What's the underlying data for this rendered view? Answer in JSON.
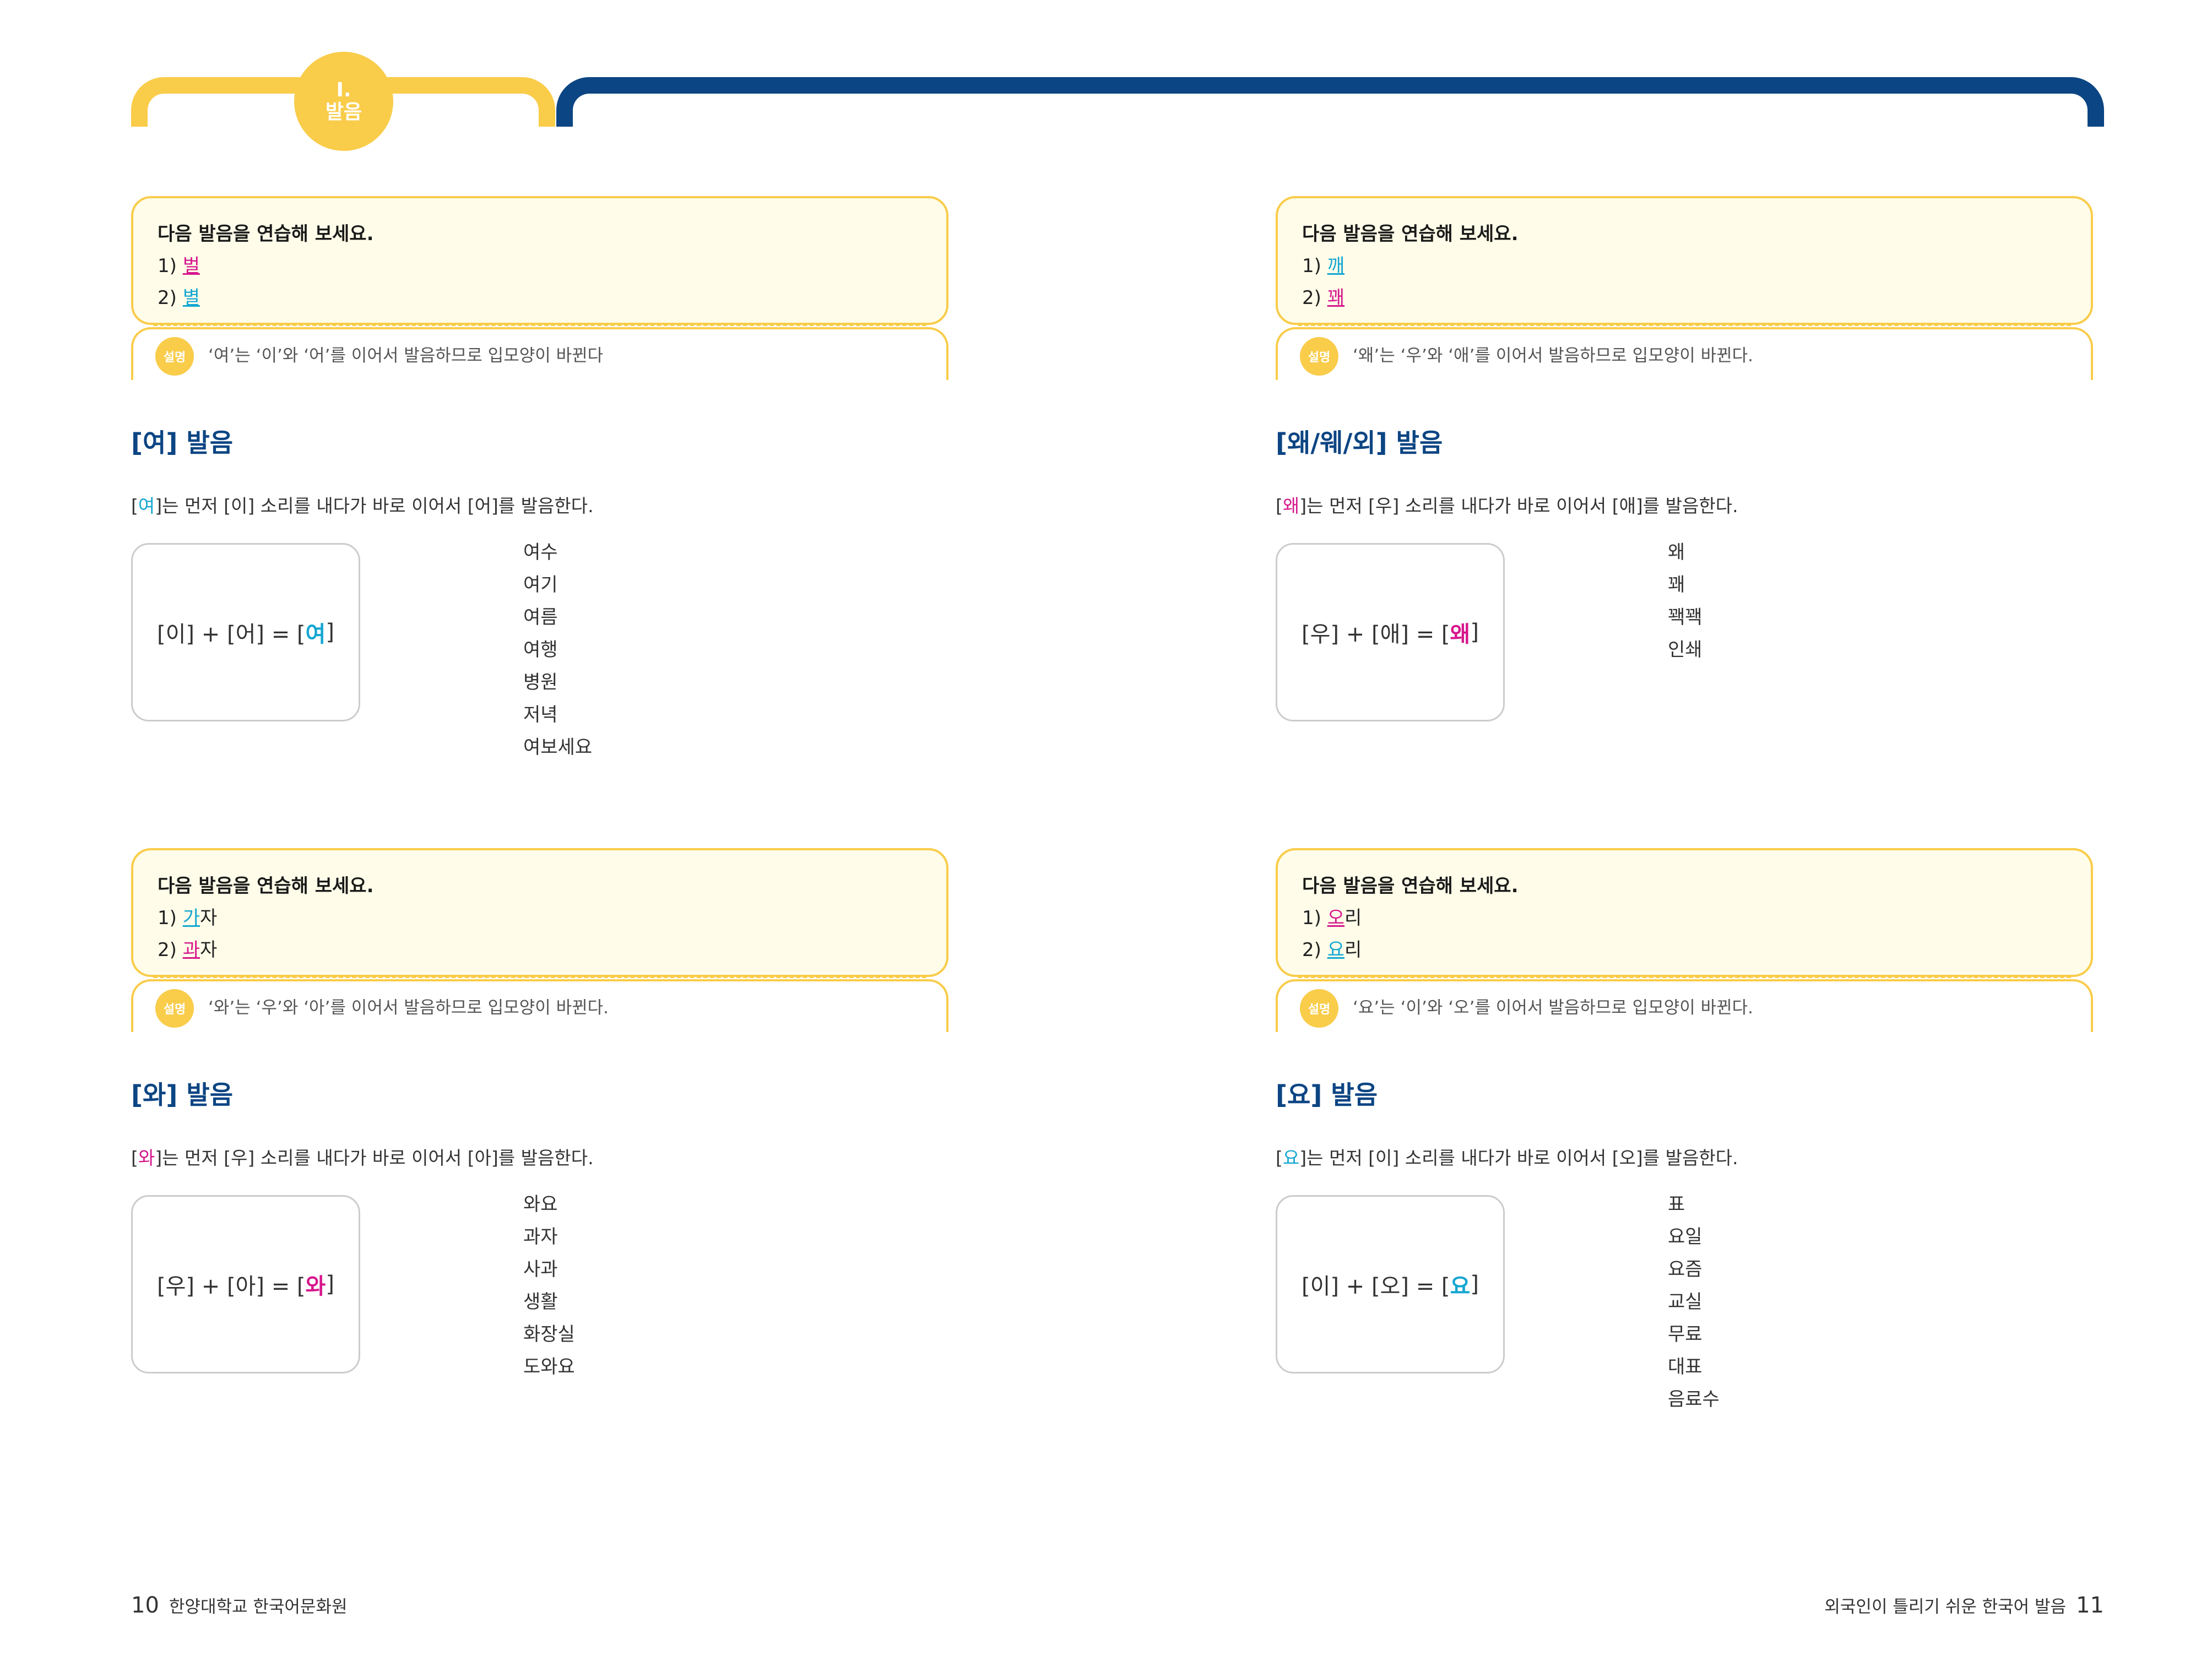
{
  "header": {
    "chapter_number": "I.",
    "chapter_title": "발음",
    "accent_yellow": "#f9cc4a",
    "accent_navy": "#0c4583"
  },
  "sections": {
    "yeo": {
      "practice_title": "다음 발음을 연습해 보세요.",
      "item1_prefix": "1) ",
      "item1_hl": "벌",
      "item1_rest": "",
      "item2_prefix": "2) ",
      "item2_hl": "별",
      "item2_rest": "",
      "explain_badge": "설명",
      "explain_text": "‘여’는 ‘이’와 ‘어’를 이어서 발음하므로 입모양이 바뀐다",
      "heading": "[여] 발음",
      "desc_open": "[",
      "desc_hl": "여",
      "desc_rest": "]는 먼저 [이] 소리를 내다가 바로 이어서 [어]를 발음한다.",
      "formula_pre": "[이] + [어] = [",
      "formula_hl": "여",
      "formula_post": "]",
      "words": [
        "여수",
        "여기",
        "여름",
        "여행",
        "병원",
        "저녁",
        "여보세요"
      ]
    },
    "wae": {
      "practice_title": "다음 발음을 연습해 보세요.",
      "item1_prefix": "1) ",
      "item1_hl": "깨",
      "item1_rest": "",
      "item2_prefix": "2) ",
      "item2_hl": "꽤",
      "item2_rest": "",
      "explain_badge": "설명",
      "explain_text": "‘왜’는 ‘우’와 ‘애’를 이어서 발음하므로 입모양이 바뀐다.",
      "heading": "[왜/웨/외] 발음",
      "desc_open": "[",
      "desc_hl": "왜",
      "desc_rest": "]는 먼저 [우] 소리를 내다가 바로 이어서 [애]를 발음한다.",
      "formula_pre": "[우] + [애] = [",
      "formula_hl": "왜",
      "formula_post": "]",
      "words": [
        "왜",
        "꽤",
        "꽥꽥",
        "인쇄"
      ]
    },
    "wa": {
      "practice_title": "다음 발음을 연습해 보세요.",
      "item1_prefix": "1) ",
      "item1_hl": "가",
      "item1_rest": "자",
      "item2_prefix": "2) ",
      "item2_hl": "과",
      "item2_rest": "자",
      "explain_badge": "설명",
      "explain_text": "‘와’는 ‘우’와 ‘아’를 이어서 발음하므로 입모양이 바뀐다.",
      "heading": "[와] 발음",
      "desc_open": "[",
      "desc_hl": "와",
      "desc_rest": "]는 먼저 [우] 소리를 내다가 바로 이어서 [아]를 발음한다.",
      "formula_pre": "[우] + [아] = [",
      "formula_hl": "와",
      "formula_post": "]",
      "words": [
        "와요",
        "과자",
        "사과",
        "생활",
        "화장실",
        "도와요"
      ]
    },
    "yo": {
      "practice_title": "다음 발음을 연습해 보세요.",
      "item1_prefix": "1) ",
      "item1_hl": "오",
      "item1_rest": "리",
      "item2_prefix": "2) ",
      "item2_hl": "요",
      "item2_rest": "리",
      "explain_badge": "설명",
      "explain_text": "‘요’는 ‘이’와 ‘오’를 이어서 발음하므로 입모양이 바뀐다.",
      "heading": "[요] 발음",
      "desc_open": "[",
      "desc_hl": "요",
      "desc_rest": "]는 먼저 [이] 소리를 내다가 바로 이어서 [오]를 발음한다.",
      "formula_pre": "[이] + [오] = [",
      "formula_hl": "요",
      "formula_post": "]",
      "words": [
        "표",
        "요일",
        "요즘",
        "교실",
        "무료",
        "대표",
        "음료수"
      ]
    }
  },
  "footer": {
    "left_page": "10",
    "left_text": "한양대학교 한국어문화원",
    "right_text": "외국인이 틀리기 쉬운 한국어 발음",
    "right_page": "11"
  }
}
